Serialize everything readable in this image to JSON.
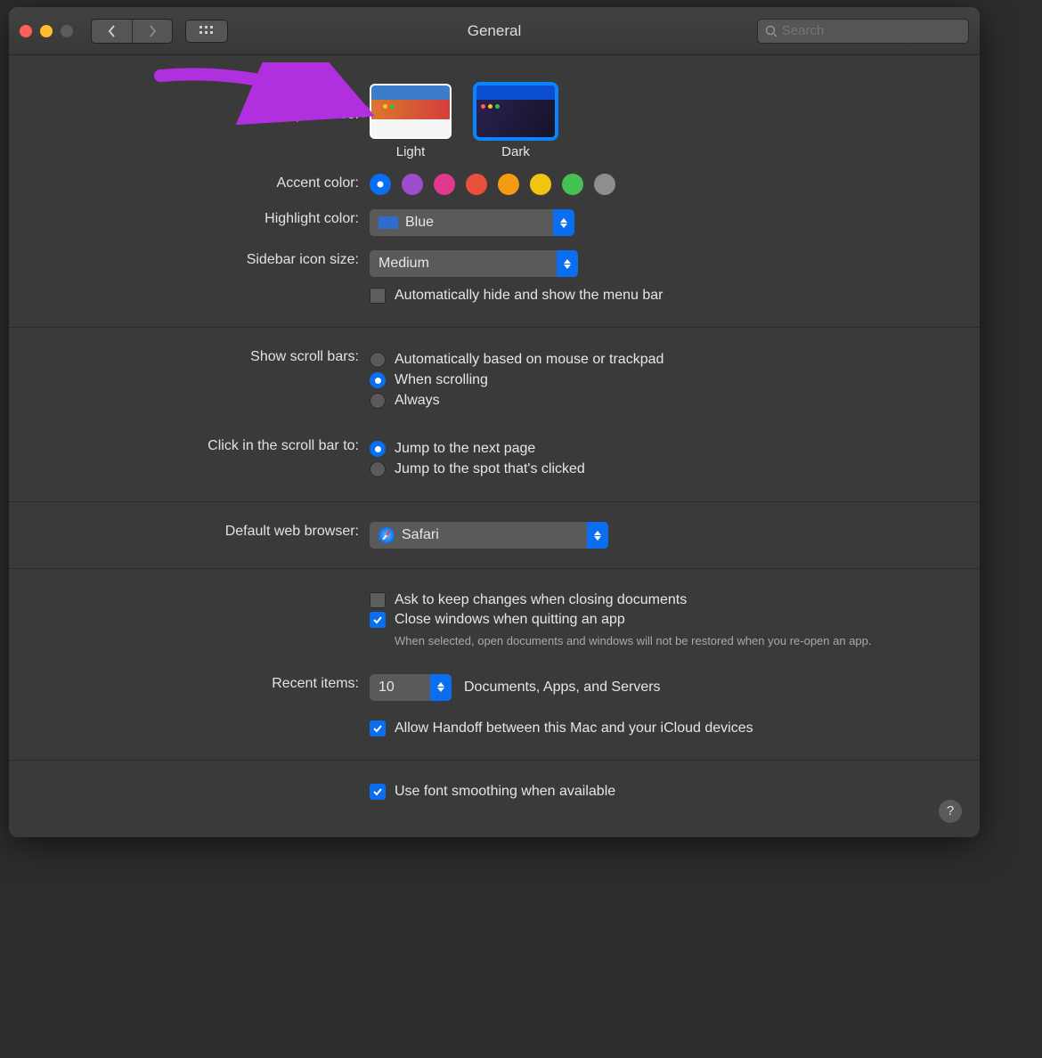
{
  "window": {
    "title": "General"
  },
  "toolbar": {
    "search_placeholder": "Search"
  },
  "appearance": {
    "label": "Appearance:",
    "options": [
      {
        "name": "Light",
        "selected": false
      },
      {
        "name": "Dark",
        "selected": true
      }
    ]
  },
  "accent": {
    "label": "Accent color:",
    "colors": [
      "#0a6ef0",
      "#9b4dca",
      "#e3388f",
      "#e94f3d",
      "#f39c12",
      "#f1c40f",
      "#45c153",
      "#8e8e8e"
    ],
    "selected_index": 0
  },
  "highlight": {
    "label": "Highlight color:",
    "value": "Blue"
  },
  "sidebar_size": {
    "label": "Sidebar icon size:",
    "value": "Medium"
  },
  "menu_bar_chk": {
    "label": "Automatically hide and show the menu bar",
    "checked": false
  },
  "scroll_bars": {
    "label": "Show scroll bars:",
    "options": [
      "Automatically based on mouse or trackpad",
      "When scrolling",
      "Always"
    ],
    "selected_index": 1
  },
  "click_scroll": {
    "label": "Click in the scroll bar to:",
    "options": [
      "Jump to the next page",
      "Jump to the spot that's clicked"
    ],
    "selected_index": 0
  },
  "browser": {
    "label": "Default web browser:",
    "value": "Safari"
  },
  "ask_changes": {
    "label": "Ask to keep changes when closing documents",
    "checked": false
  },
  "close_windows": {
    "label": "Close windows when quitting an app",
    "checked": true,
    "hint": "When selected, open documents and windows will not be restored when you re-open an app."
  },
  "recent": {
    "label": "Recent items:",
    "value": "10",
    "suffix": "Documents, Apps, and Servers"
  },
  "handoff": {
    "label": "Allow Handoff between this Mac and your iCloud devices",
    "checked": true
  },
  "font_smoothing": {
    "label": "Use font smoothing when available",
    "checked": true
  }
}
